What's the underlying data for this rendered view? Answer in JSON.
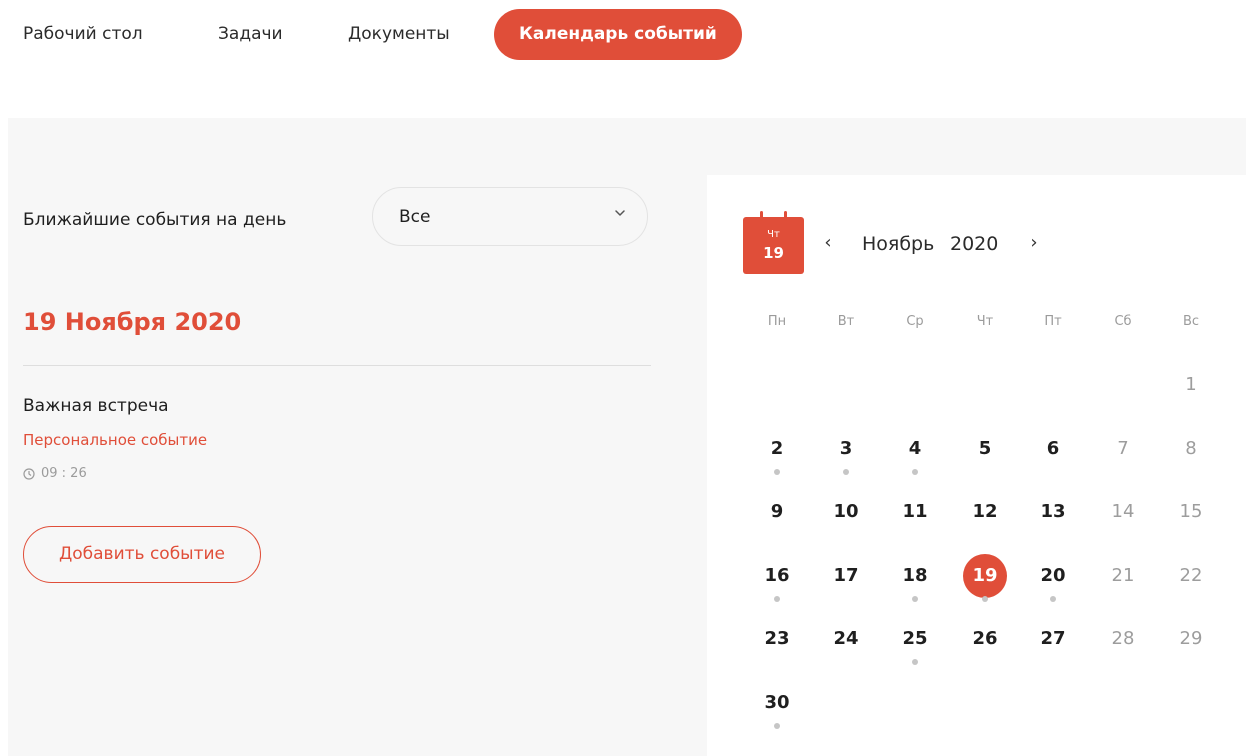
{
  "nav": {
    "tabs": [
      {
        "label": "Рабочий стол",
        "active": false
      },
      {
        "label": "Задачи",
        "active": false
      },
      {
        "label": "Документы",
        "active": false
      },
      {
        "label": "Календарь событий",
        "active": true
      }
    ]
  },
  "filter": {
    "label": "Ближайшие события на день",
    "selected": "Все"
  },
  "day_view": {
    "date": "19 Ноября 2020",
    "events": [
      {
        "title": "Важная встреча",
        "type": "Персональное событие",
        "time": "09 : 26"
      }
    ],
    "add_button": "Добавить событие"
  },
  "calendar": {
    "badge": {
      "weekday": "Чт",
      "day": "19"
    },
    "month": "Ноябрь",
    "year": "2020",
    "prev": "‹",
    "next": "›",
    "weekdays": [
      "Пн",
      "Вт",
      "Ср",
      "Чт",
      "Пт",
      "Сб",
      "Вс"
    ],
    "days": [
      "1",
      "2",
      "3",
      "4",
      "5",
      "6",
      "7",
      "8",
      "9",
      "10",
      "11",
      "12",
      "13",
      "14",
      "15",
      "16",
      "17",
      "18",
      "19",
      "20",
      "21",
      "22",
      "23",
      "24",
      "25",
      "26",
      "27",
      "28",
      "29",
      "30"
    ],
    "event_days": [
      2,
      3,
      4,
      16,
      18,
      19,
      20,
      25,
      30
    ],
    "selected_day": 19
  },
  "colors": {
    "accent": "#e04e39",
    "muted": "#9b9b9b",
    "dot": "#c6c6c6"
  }
}
